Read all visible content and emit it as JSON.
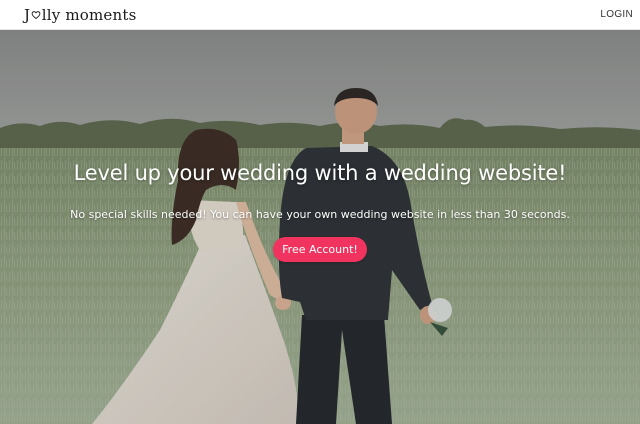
{
  "navbar": {
    "logo_prefix": "J",
    "logo_suffix": "lly moments",
    "login_label": "LOGIN"
  },
  "hero": {
    "title": "Level up your wedding with a wedding website!",
    "subtitle": "No special skills needed! You can have your own wedding website in less than 30 seconds.",
    "cta_label": "Free Account!"
  },
  "colors": {
    "accent": "#f0345f",
    "navbar_bg": "#ffffff",
    "hero_text": "#ffffff"
  },
  "icons": {
    "logo_heart": "heart-icon"
  }
}
